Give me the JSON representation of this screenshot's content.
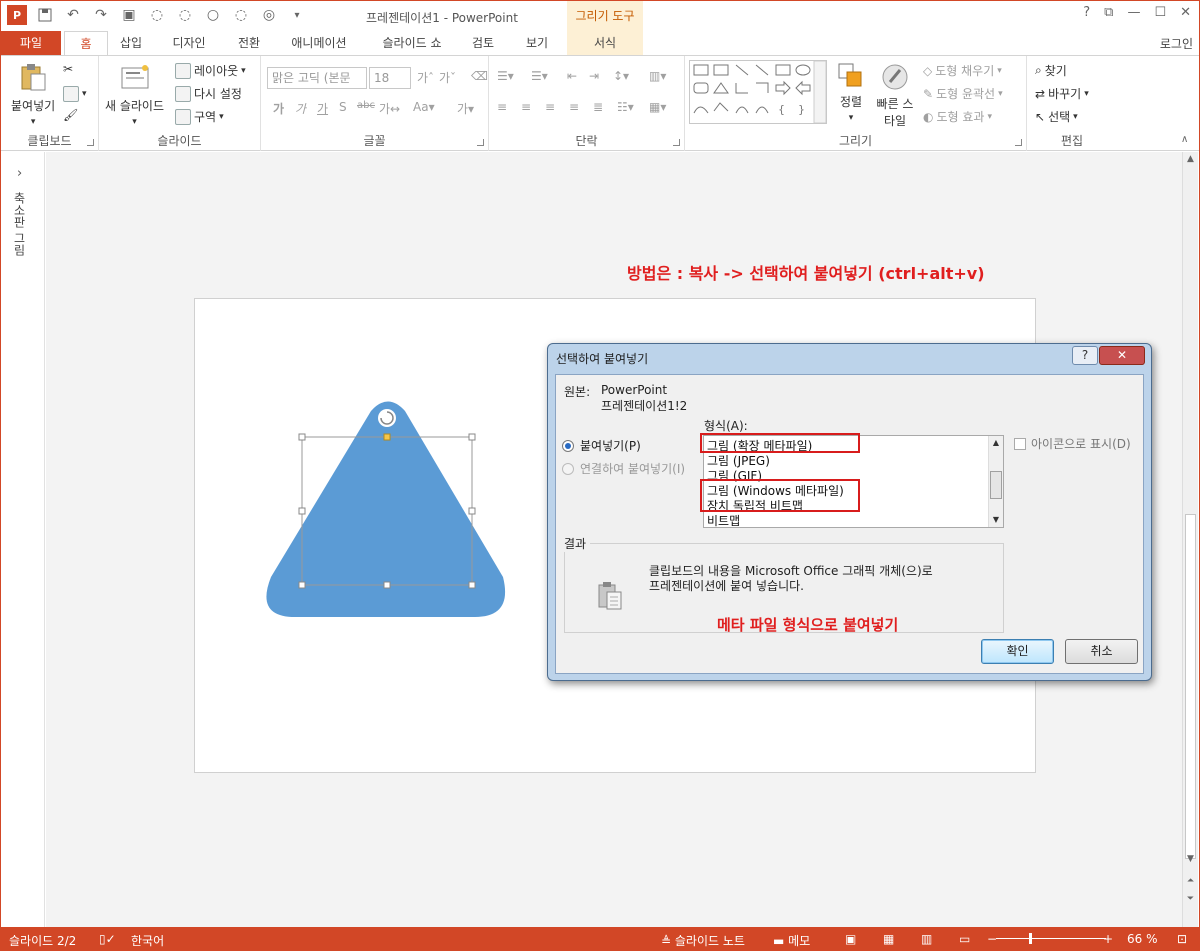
{
  "window": {
    "title": "프레젠테이션1 - PowerPoint",
    "contextual_group": "그리기 도구",
    "controls": [
      "?",
      "⧉",
      "—",
      "☐",
      "✕"
    ]
  },
  "qat": {
    "logo": "P",
    "icons": [
      "save-icon",
      "undo-icon",
      "redo-icon",
      "start-from-beginning-icon",
      "shape-icon"
    ]
  },
  "tabs": [
    {
      "label": "파일"
    },
    {
      "label": "홈"
    },
    {
      "label": "삽입"
    },
    {
      "label": "디자인"
    },
    {
      "label": "전환"
    },
    {
      "label": "애니메이션"
    },
    {
      "label": "슬라이드 쇼"
    },
    {
      "label": "검토"
    },
    {
      "label": "보기"
    },
    {
      "label": "서식"
    }
  ],
  "login": "로그인",
  "ribbon": {
    "clipboard": {
      "label": "클립보드",
      "paste": "붙여넣기"
    },
    "slides": {
      "label": "슬라이드",
      "new_slide": "새 슬라이드",
      "layout": "레이아웃",
      "reset": "다시 설정",
      "section": "구역"
    },
    "font": {
      "label": "글꼴",
      "font_name": "맑은 고딕 (본문",
      "font_size": "18"
    },
    "paragraph": {
      "label": "단락"
    },
    "drawing": {
      "label": "그리기",
      "arrange": "정렬",
      "quick_styles": "빠른 스타일",
      "shape_fill": "도형 채우기",
      "shape_outline": "도형 윤곽선",
      "shape_effects": "도형 효과"
    },
    "editing": {
      "label": "편집",
      "find": "찾기",
      "replace": "바꾸기",
      "select": "선택"
    }
  },
  "left_pane": {
    "label": "축소판 그림"
  },
  "annotation_top": "방법은 : 복사 -> 선택하여 붙여넣기 (ctrl+alt+v)",
  "dialog": {
    "title": "선택하여 붙여넣기",
    "help": "?",
    "close": "✕",
    "source_label": "원본:",
    "source_line1": "PowerPoint",
    "source_line2": "프레젠테이션1!2",
    "format_label": "형식(A):",
    "paste_option": "붙여넣기(P)",
    "paste_link_option": "연결하여 붙여넣기(I)",
    "formats": [
      "그림 (확장 메타파일)",
      "그림 (JPEG)",
      "그림 (GIF)",
      "그림 (Windows 메타파일)",
      "장치 독립적 비트맵",
      "비트맵"
    ],
    "show_as_icon": "아이콘으로 표시(D)",
    "result_label": "결과",
    "result_line1": "클립보드의 내용을 Microsoft Office 그래픽 개체(으)로",
    "result_line2": "프레젠테이션에 붙여 넣습니다.",
    "annotation": "메타 파일 형식으로 붙여넣기",
    "ok": "확인",
    "cancel": "취소"
  },
  "status": {
    "slide": "슬라이드 2/2",
    "language": "한국어",
    "notes": "슬라이드 노트",
    "comments": "메모",
    "zoom": "66 %"
  },
  "colors": {
    "accent": "#d24726",
    "shape_fill": "#5b9bd5",
    "annotation": "#e01f1f"
  }
}
